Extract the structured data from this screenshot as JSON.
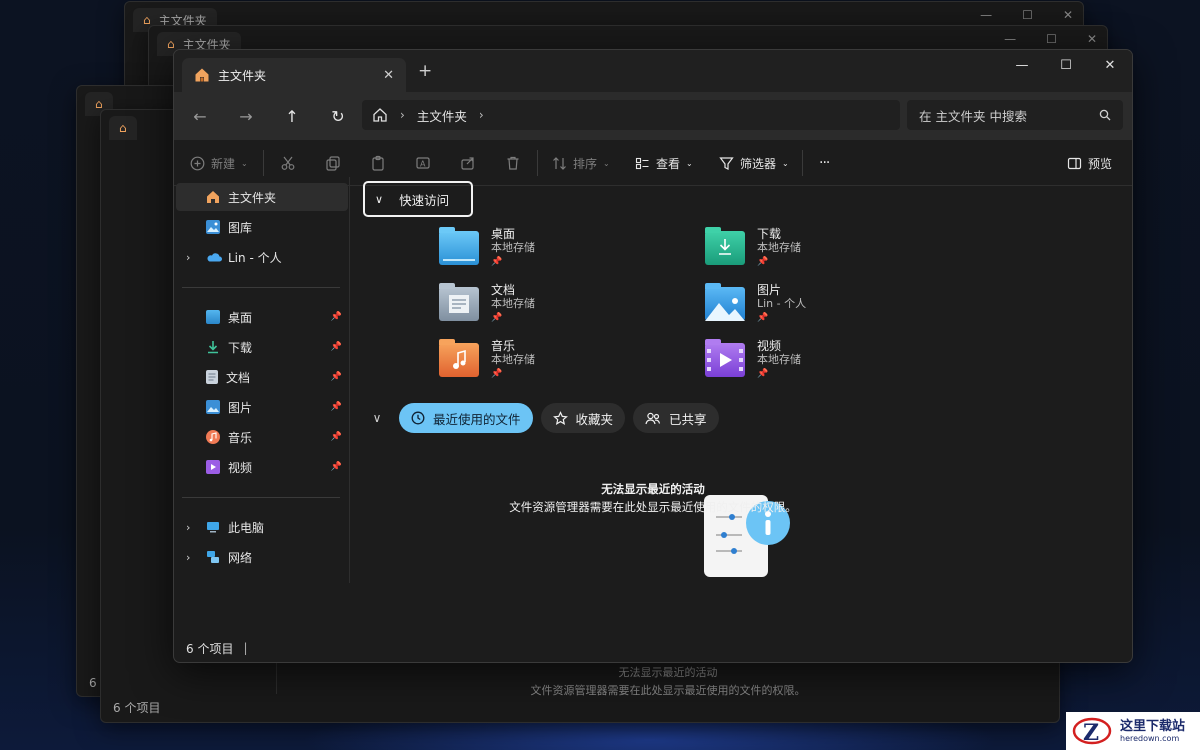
{
  "window": {
    "tab_title": "主文件夹",
    "controls": {
      "minimize": "—",
      "maximize": "☐",
      "close": "✕"
    }
  },
  "nav": {
    "back": "←",
    "forward": "→",
    "up": "↑",
    "refresh": "↻",
    "breadcrumb": [
      "主文件夹"
    ],
    "search_placeholder": "在 主文件夹 中搜索"
  },
  "toolbar": {
    "new_label": "新建",
    "sort_label": "排序",
    "view_label": "查看",
    "filter_label": "筛选器",
    "more_label": "···",
    "preview_label": "预览"
  },
  "sidebar": {
    "top": [
      {
        "label": "主文件夹",
        "icon": "home-icon",
        "selected": true
      },
      {
        "label": "图库",
        "icon": "gallery-icon"
      },
      {
        "label": "Lin - 个人",
        "icon": "onedrive-icon",
        "expandable": true
      }
    ],
    "pinned": [
      {
        "label": "桌面",
        "icon": "desktop-icon"
      },
      {
        "label": "下载",
        "icon": "download-icon"
      },
      {
        "label": "文档",
        "icon": "documents-icon"
      },
      {
        "label": "图片",
        "icon": "pictures-icon"
      },
      {
        "label": "音乐",
        "icon": "music-icon"
      },
      {
        "label": "视频",
        "icon": "videos-icon"
      }
    ],
    "bottom": [
      {
        "label": "此电脑",
        "icon": "this-pc-icon",
        "expandable": true
      },
      {
        "label": "网络",
        "icon": "network-icon",
        "expandable": true
      }
    ]
  },
  "quick_access": {
    "heading": "快速访问",
    "items": [
      {
        "name": "桌面",
        "location": "本地存储",
        "icon": "desktop-folder-icon"
      },
      {
        "name": "下载",
        "location": "本地存储",
        "icon": "downloads-folder-icon"
      },
      {
        "name": "文档",
        "location": "本地存储",
        "icon": "documents-folder-icon"
      },
      {
        "name": "图片",
        "location": "Lin - 个人",
        "icon": "pictures-folder-icon"
      },
      {
        "name": "音乐",
        "location": "本地存储",
        "icon": "music-folder-icon"
      },
      {
        "name": "视频",
        "location": "本地存储",
        "icon": "videos-folder-icon"
      }
    ]
  },
  "filters": {
    "recent": "最近使用的文件",
    "favorites": "收藏夹",
    "shared": "已共享"
  },
  "empty_state": {
    "title": "无法显示最近的活动",
    "message": "文件资源管理器需要在此处显示最近使用的文件的权限。"
  },
  "status": {
    "count": "6 个项目"
  },
  "ghost_windows": {
    "tab_title": "主文件夹",
    "status_count": "6 个项目",
    "short_count": "6",
    "empty_title": "无法显示最近的活动",
    "empty_message": "文件资源管理器需要在此处显示最近使用的文件的权限。"
  },
  "watermark": {
    "title": "这里下载站",
    "url": "heredown.com"
  },
  "colors": {
    "accent": "#6cc4f5",
    "window_bg": "#1c1c1c",
    "titlebar": "#202020"
  }
}
